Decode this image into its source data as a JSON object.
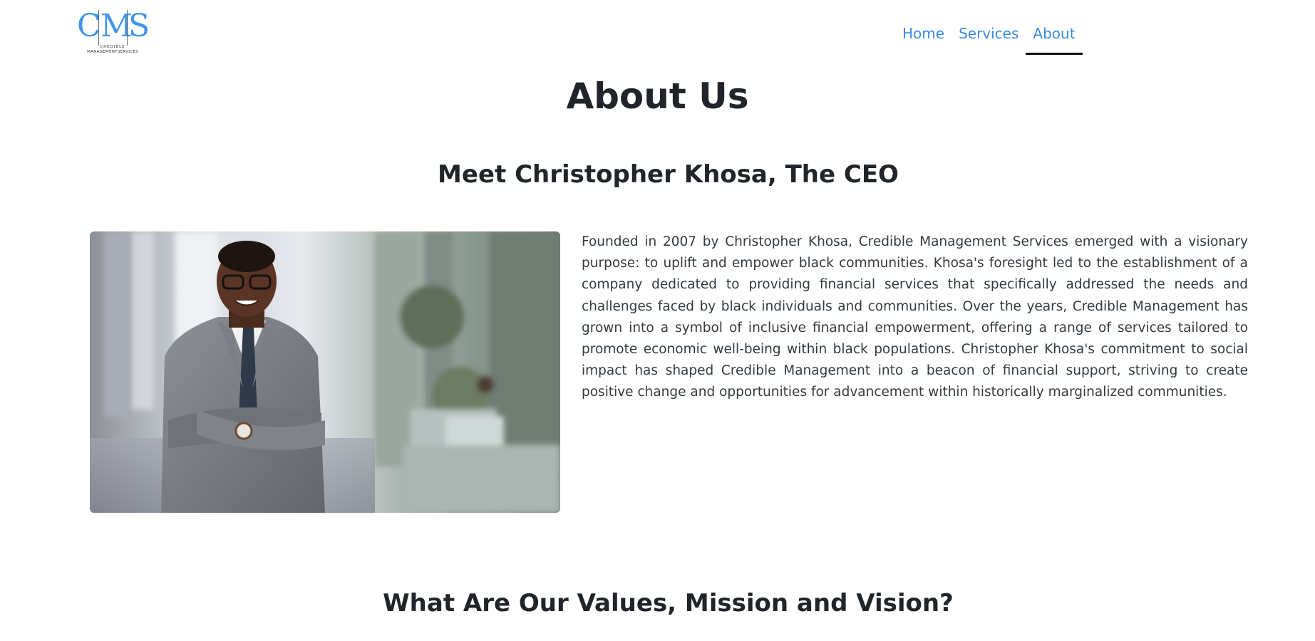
{
  "logo": {
    "letters": [
      "C",
      "M",
      "S"
    ],
    "line1": "CREDIBLE",
    "line2": "MANAGEMENTSERVICES",
    "color": "#3f97e6"
  },
  "nav": {
    "items": [
      {
        "label": "Home",
        "active": false
      },
      {
        "label": "Services",
        "active": false
      },
      {
        "label": "About",
        "active": true
      }
    ],
    "link_color": "#3a8be0"
  },
  "page_title": "About Us",
  "ceo": {
    "heading": "Meet Christopher Khosa, The CEO",
    "photo_icon": "ceo-portrait-photo",
    "bio": "Founded in 2007 by Christopher Khosa, Credible Management Services emerged with a visionary purpose: to uplift and empower black communities. Khosa's foresight led to the establishment of a company dedicated to providing financial services that specifically addressed the needs and challenges faced by black individuals and communities. Over the years, Credible Management has grown into a symbol of inclusive financial empowerment, offering a range of services tailored to promote economic well-being within black populations. Christopher Khosa's commitment to social impact has shaped Credible Management into a beacon of financial support, striving to create positive change and opportunities for advancement within historically marginalized communities."
  },
  "values_heading": "What Are Our Values, Mission and Vision?"
}
